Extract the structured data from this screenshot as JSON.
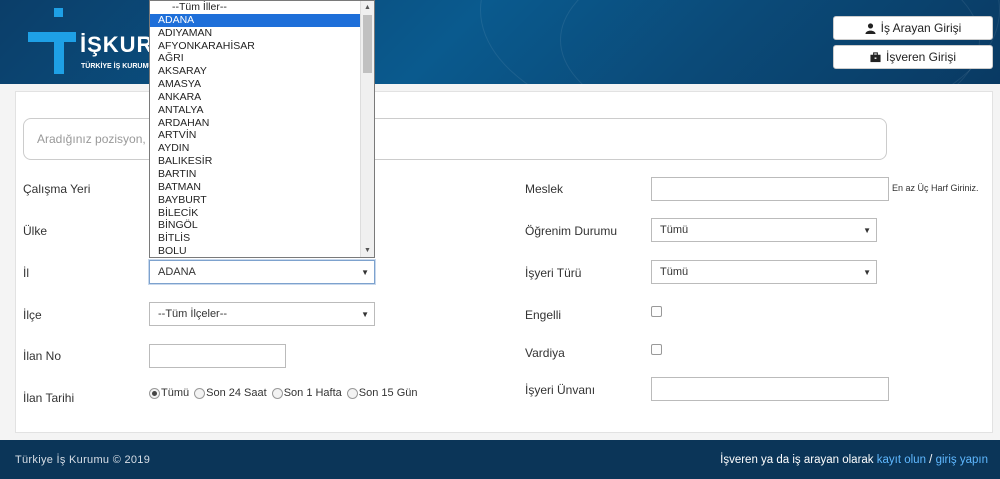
{
  "brand": {
    "logo_text": "İŞKUR",
    "logo_sub": "TÜRKİYE İŞ KURUMU"
  },
  "header": {
    "job_seeker_login": "İş Arayan Girişi",
    "employer_login": "İşveren Girişi"
  },
  "search": {
    "placeholder": "Aradığınız pozisyon, m"
  },
  "form": {
    "work_location_label": "Çalışma Yeri",
    "country_label": "Ülke",
    "province_label": "İl",
    "province_value": "ADANA",
    "district_label": "İlçe",
    "district_value": "--Tüm İlçeler--",
    "ad_no_label": "İlan No",
    "ad_date_label": "İlan Tarihi",
    "date_options": [
      "Tümü",
      "Son 24 Saat",
      "Son 1 Hafta",
      "Son 15 Gün"
    ],
    "profession_label": "Meslek",
    "profession_hint": "En az Üç Harf Giriniz.",
    "education_label": "Öğrenim Durumu",
    "education_value": "Tümü",
    "workplace_type_label": "İşyeri Türü",
    "workplace_type_value": "Tümü",
    "disabled_label": "Engelli",
    "shift_label": "Vardiya",
    "workplace_title_label": "İşyeri Ünvanı"
  },
  "province_list": {
    "items": [
      "--Tüm İller--",
      "ADANA",
      "ADIYAMAN",
      "AFYONKARAHİSAR",
      "AĞRI",
      "AKSARAY",
      "AMASYA",
      "ANKARA",
      "ANTALYA",
      "ARDAHAN",
      "ARTVİN",
      "AYDIN",
      "BALIKESİR",
      "BARTIN",
      "BATMAN",
      "BAYBURT",
      "BİLECİK",
      "BİNGÖL",
      "BİTLİS",
      "BOLU"
    ],
    "selected_index": 1
  },
  "footer": {
    "copyright": "Türkiye İş Kurumu © 2019",
    "cta_prefix": "İşveren ya da iş arayan olarak ",
    "register_link": "kayıt olun",
    "separator": " / ",
    "login_link": "giriş yapın"
  }
}
